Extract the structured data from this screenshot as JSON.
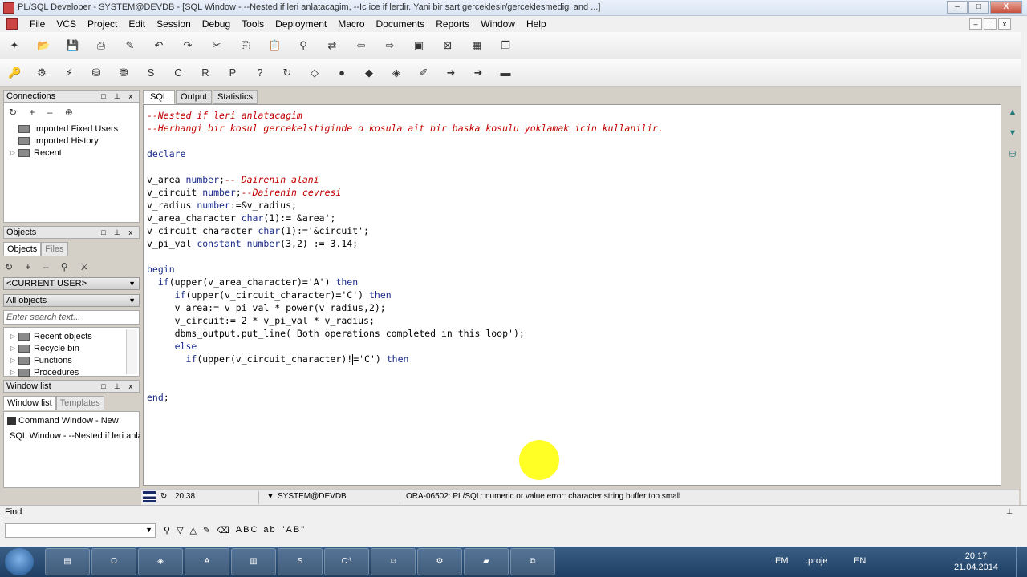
{
  "window": {
    "title": "PL/SQL Developer - SYSTEM@DEVDB - [SQL Window - --Nested if leri anlatacagim, --Ic ice if lerdir. Yani bir sart gerceklesir/gerceklesmedigi and ...]",
    "min": "–",
    "max": "□",
    "close": "X"
  },
  "menu": [
    "File",
    "VCS",
    "Project",
    "Edit",
    "Session",
    "Debug",
    "Tools",
    "Deployment",
    "Macro",
    "Documents",
    "Reports",
    "Window",
    "Help"
  ],
  "mdi": {
    "min": "–",
    "restore": "□",
    "close": "x"
  },
  "toolbar_row1": [
    {
      "name": "new-icon",
      "glyph": "✦"
    },
    {
      "name": "open-icon",
      "glyph": "📂"
    },
    {
      "name": "save-icon",
      "glyph": "💾"
    },
    {
      "name": "print-icon",
      "glyph": "⎙"
    },
    {
      "name": "edit-icon",
      "glyph": "✎"
    },
    {
      "name": "undo-icon",
      "glyph": "↶"
    },
    {
      "name": "redo-icon",
      "glyph": "↷"
    },
    {
      "name": "cut-icon",
      "glyph": "✂"
    },
    {
      "name": "copy-icon",
      "glyph": "⎘"
    },
    {
      "name": "paste-icon",
      "glyph": "📋"
    },
    {
      "name": "find-icon",
      "glyph": "⚲"
    },
    {
      "name": "replace-icon",
      "glyph": "⇄"
    },
    {
      "name": "import-icon",
      "glyph": "⇦"
    },
    {
      "name": "export-icon",
      "glyph": "⇨"
    },
    {
      "name": "window-icon",
      "glyph": "▣"
    },
    {
      "name": "close-window-icon",
      "glyph": "⊠"
    },
    {
      "name": "tile-icon",
      "glyph": "▦"
    },
    {
      "name": "cascade-icon",
      "glyph": "❐"
    }
  ],
  "toolbar_row2": [
    {
      "name": "key-icon",
      "glyph": "🔑"
    },
    {
      "name": "gear-icon",
      "glyph": "⚙"
    },
    {
      "name": "wand-icon",
      "glyph": "⚡"
    },
    {
      "name": "db-icon",
      "glyph": "⛁"
    },
    {
      "name": "db-commit-icon",
      "glyph": "⛃"
    },
    {
      "name": "sql-icon",
      "glyph": "S"
    },
    {
      "name": "cmd-icon",
      "glyph": "C"
    },
    {
      "name": "report-icon",
      "glyph": "R"
    },
    {
      "name": "plan-icon",
      "glyph": "P"
    },
    {
      "name": "help-icon",
      "glyph": "?"
    },
    {
      "name": "run-icon",
      "glyph": "↻"
    },
    {
      "name": "eraser-icon",
      "glyph": "◇"
    },
    {
      "name": "break-icon",
      "glyph": "●"
    },
    {
      "name": "step-icon",
      "glyph": "◆"
    },
    {
      "name": "step-over-icon",
      "glyph": "◈"
    },
    {
      "name": "step-out-icon",
      "glyph": "✐"
    },
    {
      "name": "arrow-right-blue-icon",
      "glyph": "➜"
    },
    {
      "name": "arrow-right-red-icon",
      "glyph": "➜"
    },
    {
      "name": "stop-icon",
      "glyph": "▬"
    }
  ],
  "connections": {
    "header": "Connections",
    "ctrls": "□ ⊥ x",
    "toolbar": "↻ + – ⊕",
    "items": [
      "Imported Fixed Users",
      "Imported History",
      "Recent"
    ]
  },
  "objects": {
    "header": "Objects",
    "ctrls": "□ ⊥ x",
    "tabs": [
      "Objects",
      "Files"
    ],
    "toolbar": "↻ + – ⚲ ⚔",
    "user_dropdown": "<CURRENT USER>",
    "filter_dropdown": "All objects",
    "search_placeholder": "Enter search text...",
    "items": [
      "Recent objects",
      "Recycle bin",
      "Functions",
      "Procedures"
    ]
  },
  "window_list": {
    "header": "Window list",
    "ctrls": "□ ⊥ x",
    "tabs": [
      "Window list",
      "Templates"
    ],
    "items": [
      "Command Window - New",
      "SQL Window - --Nested if leri anlat..."
    ]
  },
  "editor": {
    "tabs": [
      "SQL",
      "Output",
      "Statistics"
    ],
    "lines": [
      [
        {
          "t": "--Nested if leri anlatacagim",
          "c": "com"
        }
      ],
      [
        {
          "t": "--Herhangi bir kosul gercekelstiginde o kosula ait bir baska kosulu yoklamak icin kullanilir.",
          "c": "com"
        }
      ],
      [],
      [
        {
          "t": "declare",
          "c": "kw"
        }
      ],
      [],
      [
        {
          "t": "v_area ",
          "c": "id"
        },
        {
          "t": "number",
          "c": "kw"
        },
        {
          "t": ";",
          "c": "id"
        },
        {
          "t": "-- Dairenin alani",
          "c": "com"
        }
      ],
      [
        {
          "t": "v_circuit ",
          "c": "id"
        },
        {
          "t": "number",
          "c": "kw"
        },
        {
          "t": ";",
          "c": "id"
        },
        {
          "t": "--Dairenin cevresi",
          "c": "com"
        }
      ],
      [
        {
          "t": "v_radius ",
          "c": "id"
        },
        {
          "t": "number",
          "c": "kw"
        },
        {
          "t": ":=&v_radius;",
          "c": "id"
        }
      ],
      [
        {
          "t": "v_area_character ",
          "c": "id"
        },
        {
          "t": "char",
          "c": "kw"
        },
        {
          "t": "(1):='&area';",
          "c": "id"
        }
      ],
      [
        {
          "t": "v_circuit_character ",
          "c": "id"
        },
        {
          "t": "char",
          "c": "kw"
        },
        {
          "t": "(1):='&circuit';",
          "c": "id"
        }
      ],
      [
        {
          "t": "v_pi_val ",
          "c": "id"
        },
        {
          "t": "constant number",
          "c": "kw"
        },
        {
          "t": "(3,2) := 3.14;",
          "c": "id"
        }
      ],
      [],
      [
        {
          "t": "begin",
          "c": "kw"
        }
      ],
      [
        {
          "t": "  ",
          "c": "id"
        },
        {
          "t": "if",
          "c": "kw"
        },
        {
          "t": "(upper(v_area_character)='A') ",
          "c": "id"
        },
        {
          "t": "then",
          "c": "kw"
        }
      ],
      [
        {
          "t": "     ",
          "c": "id"
        },
        {
          "t": "if",
          "c": "kw"
        },
        {
          "t": "(upper(v_circuit_character)='C') ",
          "c": "id"
        },
        {
          "t": "then",
          "c": "kw"
        }
      ],
      [
        {
          "t": "     v_area:= v_pi_val * power(v_radius,2);",
          "c": "id"
        }
      ],
      [
        {
          "t": "     v_circuit:= 2 * v_pi_val * v_radius;",
          "c": "id"
        }
      ],
      [
        {
          "t": "     dbms_output.put_line('Both operations completed in this loop');",
          "c": "id"
        }
      ],
      [
        {
          "t": "     ",
          "c": "id"
        },
        {
          "t": "else",
          "c": "kw"
        }
      ],
      [
        {
          "t": "       ",
          "c": "id"
        },
        {
          "t": "if",
          "c": "kw"
        },
        {
          "t": "(upper(v_circuit_character)!",
          "c": "id"
        },
        {
          "t": "|",
          "c": "cursor"
        },
        {
          "t": "='C') ",
          "c": "id"
        },
        {
          "t": "then",
          "c": "kw"
        }
      ],
      [],
      [],
      [
        {
          "t": "end",
          "c": "kw"
        },
        {
          "t": ";",
          "c": "id"
        }
      ]
    ]
  },
  "editor_right_tools": [
    "▲",
    "▼",
    "⛁"
  ],
  "status": {
    "time": "20:38",
    "connection": "SYSTEM@DEVDB",
    "message": "ORA-06502: PL/SQL: numeric or value error: character string buffer too small"
  },
  "find": {
    "label": "Find",
    "pin": "⊥",
    "tools": [
      "⚲",
      "▽",
      "△",
      "✎",
      "⌫",
      "ABC",
      "ab",
      "\"AB\""
    ]
  },
  "taskbar": {
    "apps": [
      "▤",
      "O",
      "◈",
      "A",
      "▥",
      "S",
      "C:\\",
      "☺",
      "⚙",
      "▰",
      "⧉"
    ],
    "tray_lang1": "EM",
    "tray_proj": ".proje",
    "tray_lang2": "EN",
    "time": "20:17",
    "date": "21.04.2014"
  }
}
